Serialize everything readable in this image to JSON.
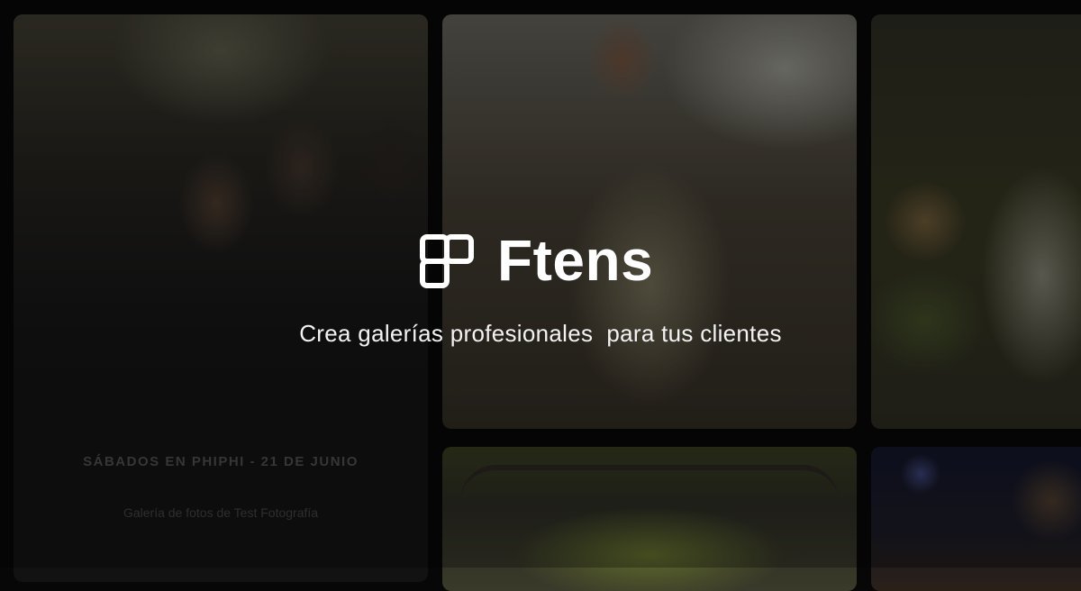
{
  "brand": {
    "name": "Ftens",
    "logo_icon": "grid-logo-icon",
    "tagline": "Crea galerías profesionales  para tus clientes"
  },
  "gallery_card": {
    "title": "SÁBADOS EN PHIPHI - 21 DE JUNIO",
    "subtitle": "Galería de fotos de Test Fotografía"
  },
  "colors": {
    "background": "#070707",
    "text_primary": "#ffffff",
    "text_muted": "#4b4b4b"
  }
}
